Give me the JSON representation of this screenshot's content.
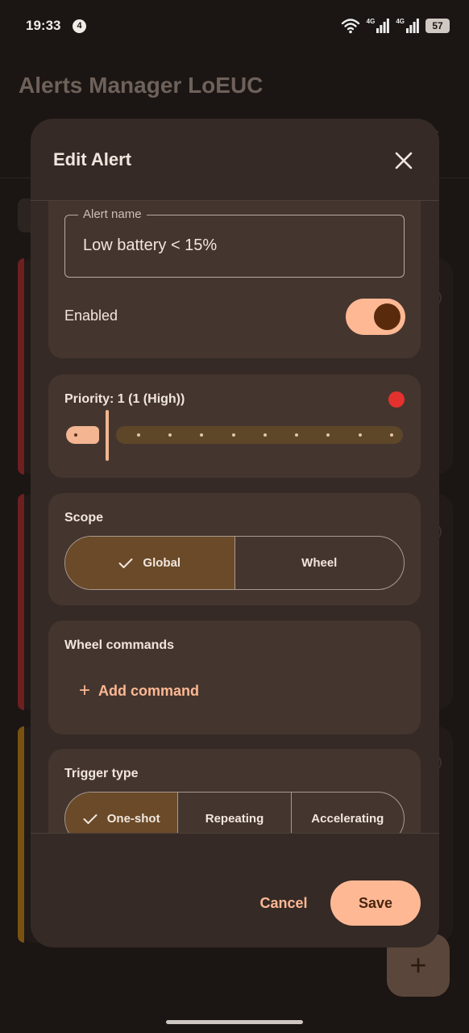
{
  "status_bar": {
    "time": "19:33",
    "notification_count": "4",
    "network_1": "4G",
    "network_2": "4G",
    "battery": "57"
  },
  "app": {
    "title": "Alerts Manager LoEUC",
    "tab_fragment": "s"
  },
  "dialog": {
    "title": "Edit Alert",
    "name_field": {
      "label": "Alert name",
      "value": "Low battery < 15%"
    },
    "enabled": {
      "label": "Enabled",
      "checked": true
    },
    "priority": {
      "label": "Priority: 1 (1 (High))",
      "value": 1,
      "min": 1,
      "max": 10,
      "indicator_color": "#e4312d"
    },
    "scope": {
      "label": "Scope",
      "options": [
        "Global",
        "Wheel"
      ],
      "selected": "Global"
    },
    "wheel_commands": {
      "label": "Wheel commands",
      "add_label": "Add command"
    },
    "trigger_type": {
      "label": "Trigger type",
      "options": [
        "One-shot",
        "Repeating",
        "Accelerating"
      ],
      "selected": "One-shot"
    },
    "cancel_label": "Cancel",
    "save_label": "Save"
  },
  "colors": {
    "accent": "#ffb894",
    "selected_segment": "#6a4a28",
    "dialog_bg": "#352a25",
    "card_bg": "#44362f"
  },
  "icons": {
    "close": "close-icon",
    "check": "check-icon",
    "add": "add-icon",
    "fab": "add-icon"
  }
}
